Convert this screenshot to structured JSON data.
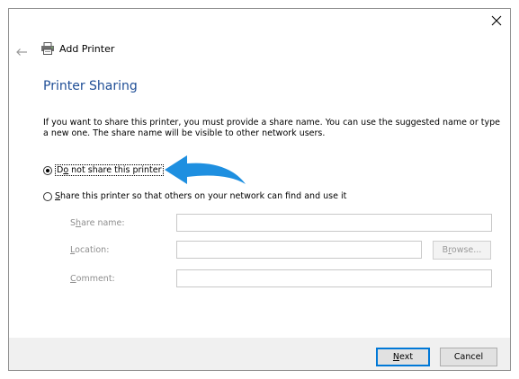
{
  "window": {
    "title": "Add Printer"
  },
  "page": {
    "heading": "Printer Sharing",
    "description": "If you want to share this printer, you must provide a share name. You can use the suggested name or type a new one. The share name will be visible to other network users."
  },
  "options": {
    "no_share": {
      "pre": "D",
      "accel": "o",
      "post": " not share this printer",
      "selected": true
    },
    "share": {
      "pre": "",
      "accel": "S",
      "post": "hare this printer so that others on your network can find and use it",
      "selected": false
    }
  },
  "fields": {
    "share_name": {
      "pre": "S",
      "accel": "h",
      "post": "are name:",
      "value": ""
    },
    "location": {
      "pre": "",
      "accel": "L",
      "post": "ocation:",
      "value": ""
    },
    "comment": {
      "pre": "",
      "accel": "C",
      "post": "omment:",
      "value": ""
    }
  },
  "browse": {
    "pre": "B",
    "accel": "r",
    "post": "owse..."
  },
  "footer": {
    "next": {
      "pre": "",
      "accel": "N",
      "post": "ext"
    },
    "cancel": "Cancel"
  },
  "annotation": {
    "arrow_color": "#1e8fe0"
  },
  "colors": {
    "heading": "#1f4e96",
    "accent": "#0078d7"
  }
}
